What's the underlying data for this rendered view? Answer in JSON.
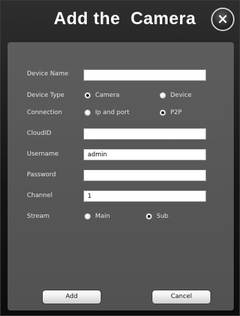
{
  "dialog": {
    "title": "Add the  Camera",
    "close_label": "×"
  },
  "form": {
    "device_name": {
      "label": "Device Name",
      "value": ""
    },
    "device_type": {
      "label": "Device Type",
      "options": [
        {
          "label": "Camera",
          "checked": true
        },
        {
          "label": "Device",
          "checked": false
        }
      ]
    },
    "connection": {
      "label": "Connection",
      "options": [
        {
          "label": "Ip and port",
          "checked": false
        },
        {
          "label": "P2P",
          "checked": true
        }
      ]
    },
    "cloud_id": {
      "label": "CloudID",
      "value": ""
    },
    "username": {
      "label": "Username",
      "value": "admin"
    },
    "password": {
      "label": "Password",
      "value": ""
    },
    "channel": {
      "label": "Channel",
      "value": "1"
    },
    "stream": {
      "label": "Stream",
      "options": [
        {
          "label": "Main",
          "checked": false
        },
        {
          "label": "Sub",
          "checked": true
        }
      ]
    }
  },
  "buttons": {
    "add_label": "Add",
    "cancel_label": "Cancel"
  }
}
